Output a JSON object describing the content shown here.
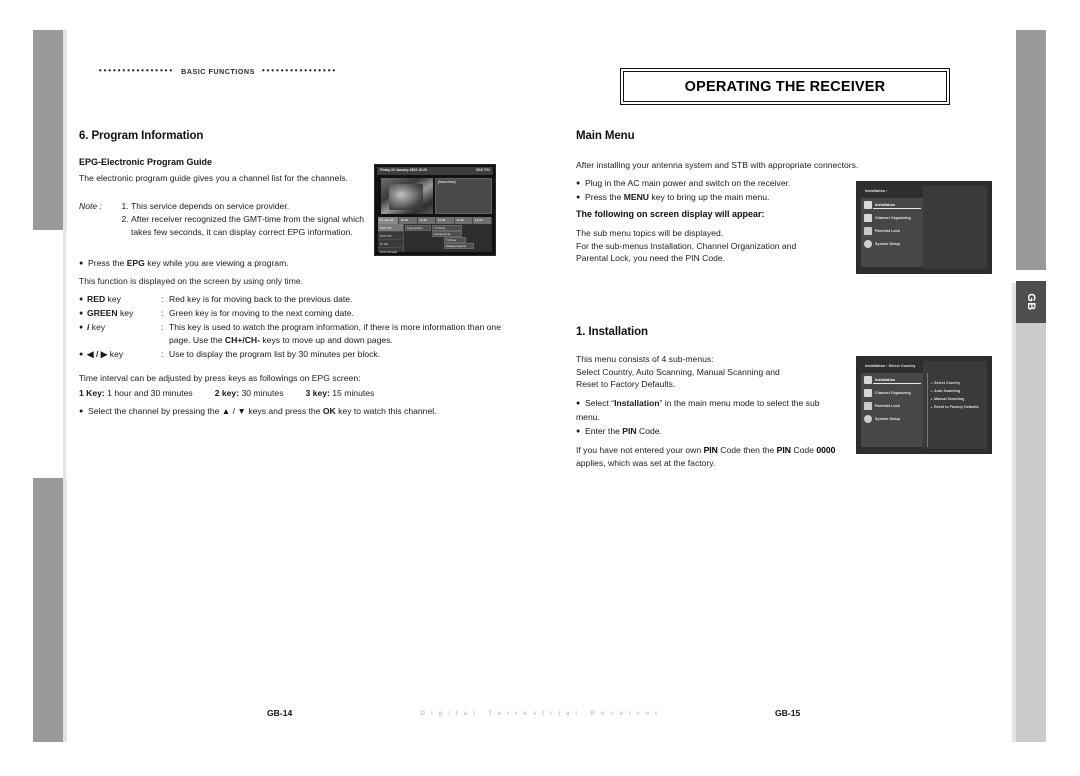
{
  "left_page": {
    "running_head": {
      "dots_left": "••••••••••••••••",
      "label": "BASIC FUNCTIONS",
      "dots_right": "••••••••••••••••"
    },
    "section_title": "6. Program Information",
    "sub_head": "EPG-Electronic Program Guide",
    "intro": "The electronic program guide gives you a channel list for the channels.",
    "note": {
      "label": "Note :",
      "items": [
        "This service depends on service provider.",
        "After receiver recognized the GMT-time from the signal which takes few seconds, it can display correct EPG information."
      ]
    },
    "bullet_epg_pre": "Press the ",
    "bullet_epg_key": "EPG",
    "bullet_epg_post": " key while you are viewing a program.",
    "function_line": "This function is displayed on the screen by using only time.",
    "keys": [
      {
        "name": "RED",
        "suffix": " key",
        "desc": "Red key is for moving back to the previous date."
      },
      {
        "name": "GREEN",
        "suffix": " key",
        "desc": "Green key is for moving to the next coming date."
      },
      {
        "name": "i",
        "suffix": " key",
        "desc_pre": "This key is used to watch the program information, if there is more information than one page. Use the ",
        "desc_key": "CH+/CH-",
        "desc_post": " keys to move up and down pages."
      },
      {
        "name": "◀ / ▶",
        "suffix": " key",
        "desc": "Use to display the program list by 30 minutes per block."
      }
    ],
    "interval_line": "Time interval can be adjusted by press keys as followings on EPG screen:",
    "timings": [
      {
        "key": "1 Key:",
        "value": " 1 hour and 30 minutes"
      },
      {
        "key": "2 key:",
        "value": " 30 minutes"
      },
      {
        "key": "3 key:",
        "value": " 15 minutes"
      }
    ],
    "select_bullet": {
      "pre": "Select the channel by pressing the ▲ / ▼ keys and press the ",
      "key": "OK",
      "post": " key to watch this channel."
    },
    "epg_screenshot": {
      "title_bar_left": "Friday 24 January 2003 10:23",
      "title_bar_right": "VOX TV1",
      "info_title": "(Now-Next)",
      "time_columns": [
        "Fri Jan 24",
        "10:00",
        "10:30",
        "11:00",
        "11:30",
        "12:00"
      ],
      "channels": [
        "VOX TV1",
        "VOX TV2",
        "TV CH",
        "VOX Filmwelt"
      ],
      "programs": [
        "Tagesschau",
        "TV Serie",
        "Kulturjournal",
        "T-Movie",
        "Mittagsmagazin"
      ]
    },
    "folio": "GB-14"
  },
  "right_page": {
    "banner_title": "OPERATING THE RECEIVER",
    "main_menu": {
      "title": "Main Menu",
      "intro": "After installing your antenna system and STB with appropriate connectors.",
      "bullets": [
        {
          "text": "Plug in the AC main power and switch on the receiver."
        },
        {
          "pre": "Press the ",
          "key": "MENU",
          "post": " key to bring up the main menu."
        }
      ],
      "sub_head": "The following on screen display will appear:",
      "paragraph": "The sub menu topics will be displayed.\nFor the sub-menus Installation, Channel Organization and\nParental Lock, you need the PIN Code.",
      "screenshot": {
        "header": "Installation ›",
        "items": [
          {
            "label": "Installation",
            "icon": "flag-icon",
            "active": true
          },
          {
            "label": "Channel Organizing",
            "icon": "list-icon",
            "active": false
          },
          {
            "label": "Parental Lock",
            "icon": "lock-icon",
            "active": false
          },
          {
            "label": "System Setup",
            "icon": "gear-icon",
            "active": false
          }
        ]
      }
    },
    "installation": {
      "title": "1. Installation",
      "paragraph": "This menu consists of 4 sub-menus:\nSelect Country, Auto Scanning, Manual Scanning and\nReset to Factory Defaults.",
      "bullets": [
        {
          "pre": "Select “",
          "key": "Installation",
          "post": "” in the main menu mode to select the sub menu."
        },
        {
          "pre": "Enter the ",
          "key": "PIN",
          "post": " Code."
        }
      ],
      "closing_pre": "If you have not entered your own ",
      "closing_key1": "PIN",
      "closing_mid": " Code then the ",
      "closing_key2": "PIN",
      "closing_mid2": " Code ",
      "closing_key3": "0000",
      "closing_post": " applies, which was set at the factory.",
      "screenshot": {
        "header": "Installation › Select Country",
        "items": [
          {
            "label": "Installation",
            "icon": "flag-icon",
            "active": true
          },
          {
            "label": "Channel Organizing",
            "icon": "list-icon",
            "active": false
          },
          {
            "label": "Parental Lock",
            "icon": "lock-icon",
            "active": false
          },
          {
            "label": "System Setup",
            "icon": "gear-icon",
            "active": false
          }
        ],
        "sub_items": [
          "Select Country",
          "Auto Scanning",
          "Manual Scanning",
          "Reset to Factory Defaults"
        ]
      }
    },
    "folio": "GB-15"
  },
  "footer_brand": "Digital Terrestrial Receiver",
  "side_tab": {
    "label": "GB"
  },
  "colors": {
    "strip_dark": "#9a9a9a",
    "strip_light": "#cbcbcb",
    "tab": "#4e4e4e",
    "ink": "#1a1a1a"
  }
}
